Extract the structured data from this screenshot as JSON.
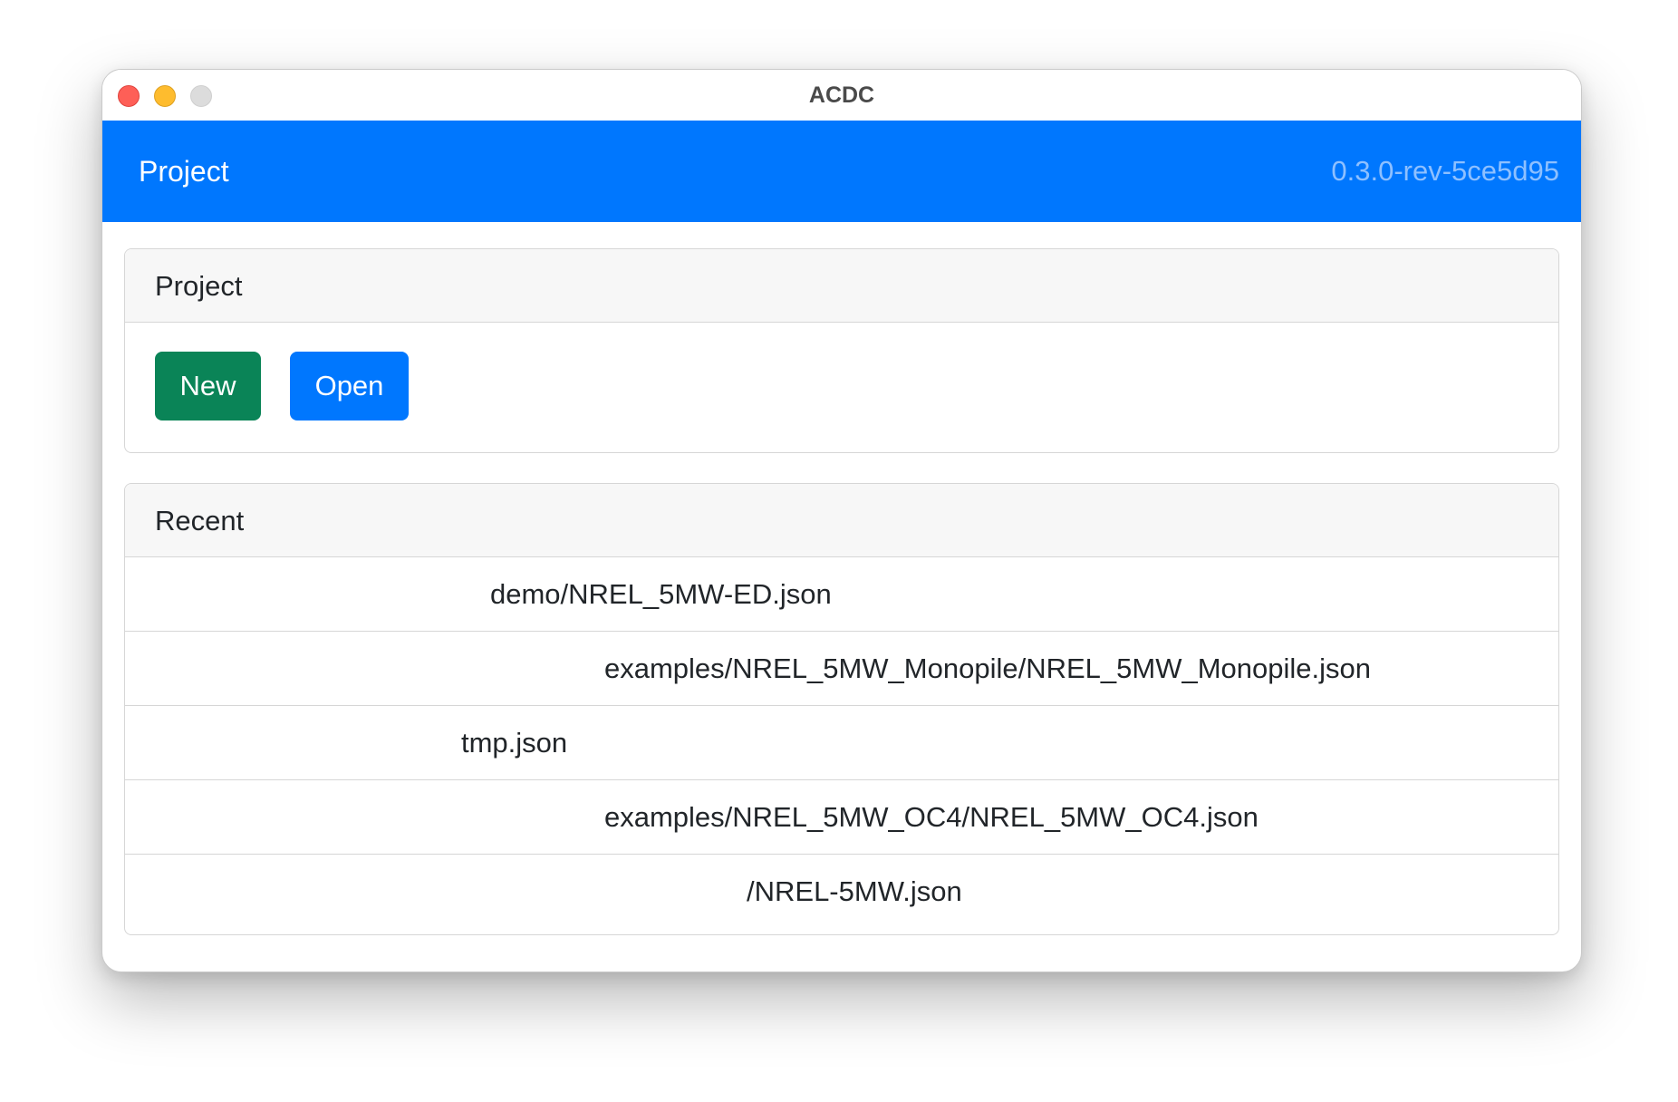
{
  "window": {
    "title": "ACDC"
  },
  "navbar": {
    "title": "Project",
    "version": "0.3.0-rev-5ce5d95"
  },
  "project_card": {
    "header": "Project",
    "new_label": "New",
    "open_label": "Open"
  },
  "recent_card": {
    "header": "Recent",
    "items": [
      "demo/NREL_5MW-ED.json",
      "examples/NREL_5MW_Monopile/NREL_5MW_Monopile.json",
      "tmp.json",
      "examples/NREL_5MW_OC4/NREL_5MW_OC4.json",
      "/NREL-5MW.json"
    ]
  },
  "colors": {
    "navbar": "#0077fe",
    "new_button": "#0a8457",
    "open_button": "#0077fe",
    "version_text": "#8ec0ff"
  }
}
